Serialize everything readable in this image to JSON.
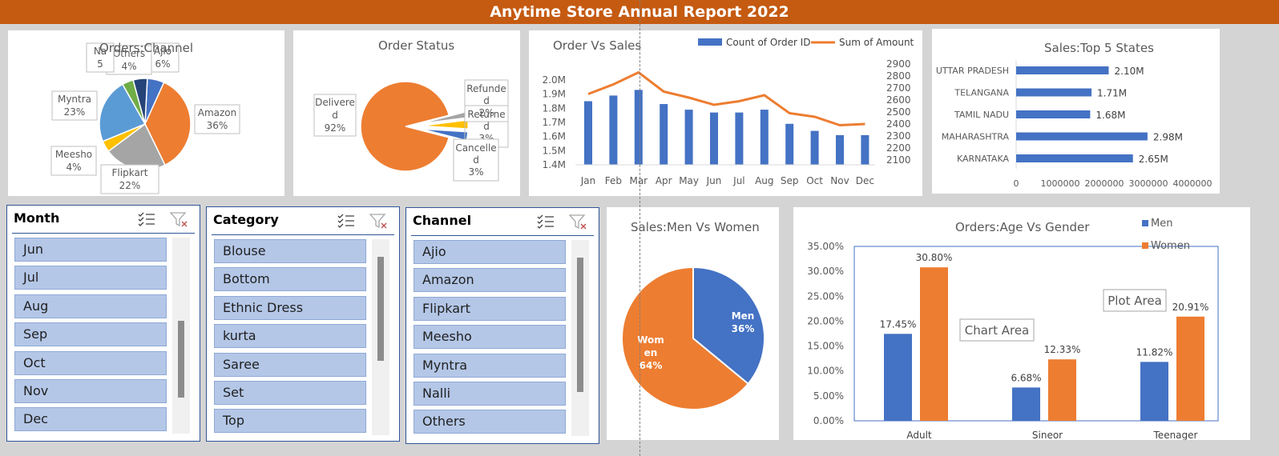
{
  "report_title": "Anytime Store Annual Report 2022",
  "orders_channel": {
    "title": "Orders:Channel",
    "slices": [
      {
        "label": "Ajio",
        "pct": "6%",
        "color": "#4472c4"
      },
      {
        "label": "Amazon",
        "pct": "36%",
        "color": "#ed7d31"
      },
      {
        "label": "Flipkart",
        "pct": "22%",
        "color": "#a5a5a5"
      },
      {
        "label": "Meesho",
        "pct": "4%",
        "color": "#ffc000"
      },
      {
        "label": "Myntra",
        "pct": "23%",
        "color": "#5b9bd5"
      },
      {
        "label": "Others",
        "pct": "4%",
        "color": "#70ad47"
      },
      {
        "label": "Na",
        "pct": "5",
        "color": "#264478"
      }
    ]
  },
  "order_status": {
    "title": "Order Status",
    "delivered": {
      "label_1": "Delivere",
      "label_2": "d",
      "pct": "92%"
    },
    "refunded": {
      "label_1": "Refunde",
      "label_2": "d",
      "pct": "2%"
    },
    "returned": {
      "label_1": "Returne",
      "label_2": "d",
      "pct": "3%"
    },
    "cancelled": {
      "label_1": "Cancelle",
      "label_2": "d",
      "pct": "3%"
    }
  },
  "order_vs_sales": {
    "title": "Order Vs Sales",
    "legend_bar": "Count of Order ID",
    "legend_line": "Sum of Amount",
    "months": [
      "Jan",
      "Feb",
      "Mar",
      "Apr",
      "May",
      "Jun",
      "Jul",
      "Aug",
      "Sep",
      "Oct",
      "Nov",
      "Dec"
    ],
    "left_ticks": [
      "2.0M",
      "1.9M",
      "1.8M",
      "1.7M",
      "1.6M",
      "1.5M",
      "1.4M"
    ],
    "right_ticks": [
      "2900",
      "2800",
      "2700",
      "2600",
      "2500",
      "2400",
      "2300",
      "2200",
      "2100"
    ]
  },
  "top_states": {
    "title": "Sales:Top 5 States",
    "states": [
      {
        "name": "UTTAR PRADESH",
        "label": "2.10M"
      },
      {
        "name": "TELANGANA",
        "label": "1.71M"
      },
      {
        "name": "TAMIL NADU",
        "label": "1.68M"
      },
      {
        "name": "MAHARASHTRA",
        "label": "2.98M"
      },
      {
        "name": "KARNATAKA",
        "label": "2.65M"
      }
    ],
    "x_ticks": [
      "0",
      "1000000",
      "2000000",
      "3000000",
      "4000000"
    ]
  },
  "slicer_month": {
    "header": "Month",
    "items": [
      "Jun",
      "Jul",
      "Aug",
      "Sep",
      "Oct",
      "Nov",
      "Dec"
    ]
  },
  "slicer_category": {
    "header": "Category",
    "items": [
      "Blouse",
      "Bottom",
      "Ethnic Dress",
      "kurta",
      "Saree",
      "Set",
      "Top"
    ]
  },
  "slicer_channel": {
    "header": "Channel",
    "items": [
      "Ajio",
      "Amazon",
      "Flipkart",
      "Meesho",
      "Myntra",
      "Nalli",
      "Others"
    ]
  },
  "men_women": {
    "title": "Sales:Men Vs Women",
    "men": {
      "label": "Men",
      "pct": "36%",
      "color": "#4472c4"
    },
    "women": {
      "label_1": "Wom",
      "label_2": "en",
      "pct": "64%",
      "color": "#ed7d31"
    }
  },
  "age_gender": {
    "title": "Orders:Age Vs Gender",
    "legend_men": "Men",
    "legend_women": "Women",
    "tooltip_chart_area": "Chart Area",
    "tooltip_plot_area": "Plot Area",
    "y_ticks": [
      "35.00%",
      "30.00%",
      "25.00%",
      "20.00%",
      "15.00%",
      "10.00%",
      "5.00%",
      "0.00%"
    ]
  },
  "chart_data": [
    {
      "type": "pie",
      "title": "Orders:Channel",
      "categories": [
        "Ajio",
        "Amazon",
        "Flipkart",
        "Meesho",
        "Myntra",
        "Others",
        "Na"
      ],
      "values": [
        6,
        36,
        22,
        4,
        23,
        4,
        5
      ]
    },
    {
      "type": "pie",
      "title": "Order Status",
      "categories": [
        "Delivered",
        "Refunded",
        "Returned",
        "Cancelled"
      ],
      "values": [
        92,
        2,
        3,
        3
      ]
    },
    {
      "type": "bar",
      "title": "Order Vs Sales",
      "categories": [
        "Jan",
        "Feb",
        "Mar",
        "Apr",
        "May",
        "Jun",
        "Jul",
        "Aug",
        "Sep",
        "Oct",
        "Nov",
        "Dec"
      ],
      "series": [
        {
          "name": "Count of Order ID",
          "axis": "left",
          "values": [
            1.85,
            1.89,
            1.93,
            1.83,
            1.79,
            1.77,
            1.77,
            1.79,
            1.69,
            1.64,
            1.61,
            1.61
          ]
        },
        {
          "name": "Sum of Amount",
          "type": "line",
          "axis": "right",
          "values": [
            2650,
            2730,
            2830,
            2670,
            2620,
            2560,
            2590,
            2640,
            2490,
            2460,
            2390,
            2400
          ]
        }
      ],
      "ylim": [
        1.4,
        2.0
      ],
      "y2lim": [
        2100,
        2900
      ],
      "legend": "top"
    },
    {
      "type": "bar",
      "title": "Sales:Top 5 States",
      "categories": [
        "UTTAR PRADESH",
        "TELANGANA",
        "TAMIL NADU",
        "MAHARASHTRA",
        "KARNATAKA"
      ],
      "values": [
        2100000,
        1710000,
        1680000,
        2980000,
        2650000
      ],
      "xlim": [
        0,
        4000000
      ],
      "orientation": "horizontal"
    },
    {
      "type": "pie",
      "title": "Sales:Men Vs Women",
      "categories": [
        "Men",
        "Women"
      ],
      "values": [
        36,
        64
      ]
    },
    {
      "type": "bar",
      "title": "Orders:Age Vs Gender",
      "categories": [
        "Adult",
        "Sineor",
        "Teenager"
      ],
      "series": [
        {
          "name": "Men",
          "values": [
            17.45,
            6.68,
            11.82
          ],
          "labels": [
            "17.45%",
            "6.68%",
            "11.82%"
          ]
        },
        {
          "name": "Women",
          "values": [
            30.8,
            12.33,
            20.91
          ],
          "labels": [
            "30.80%",
            "12.33%",
            "20.91%"
          ]
        }
      ],
      "ylim": [
        0,
        35
      ],
      "legend": "top-right"
    }
  ]
}
